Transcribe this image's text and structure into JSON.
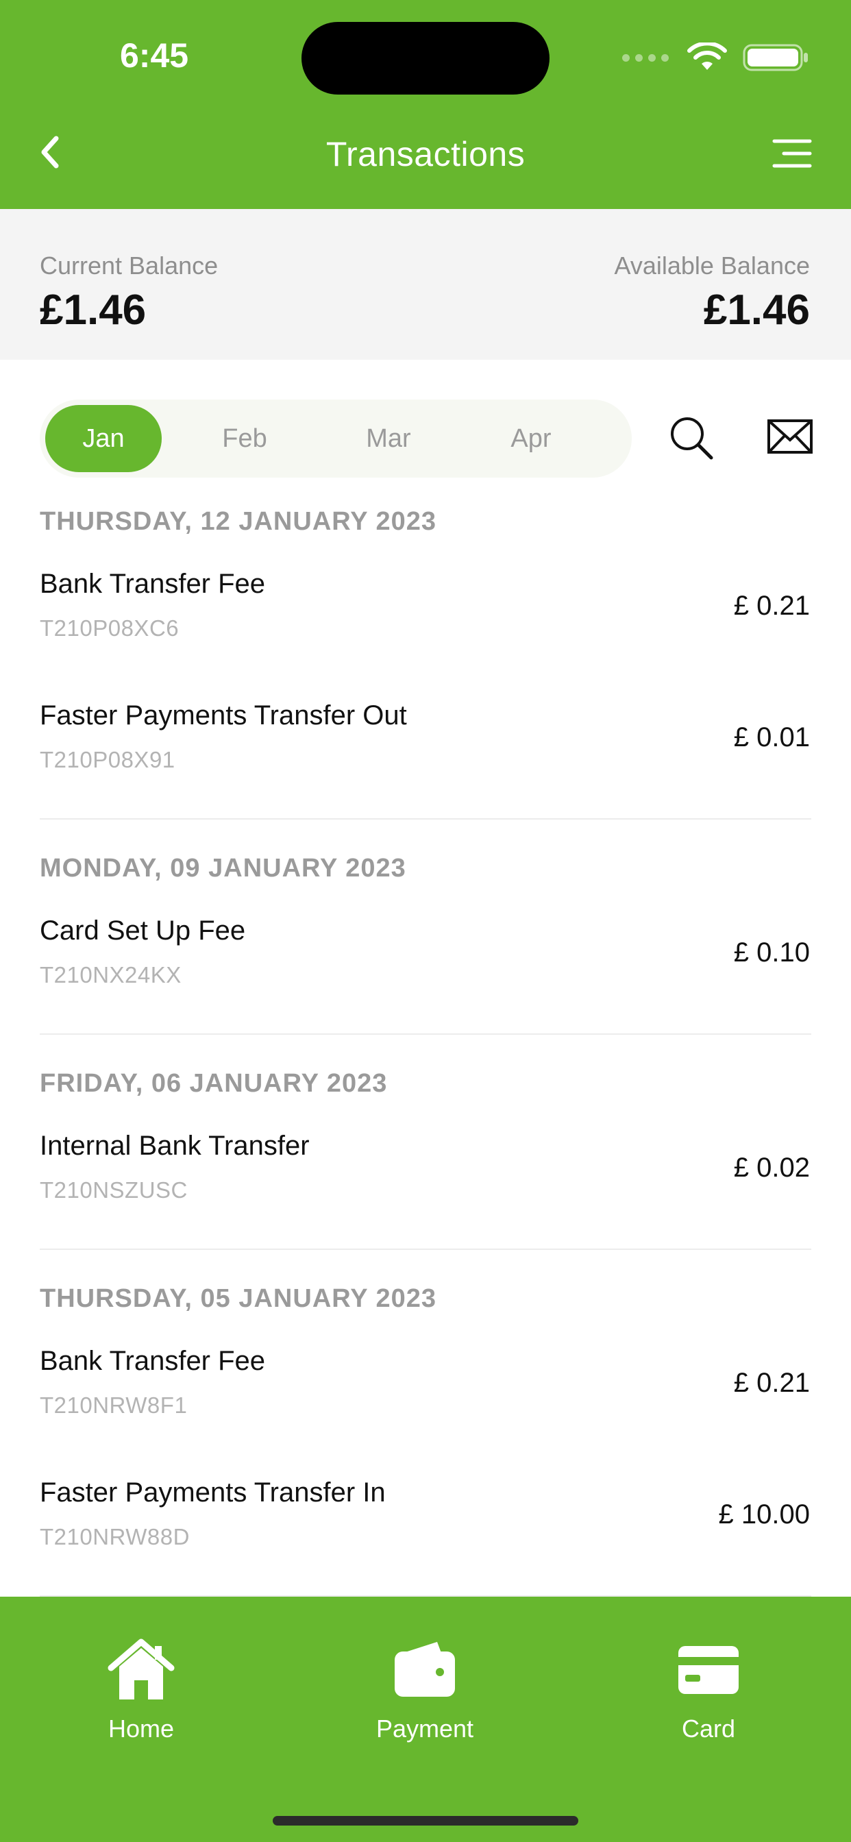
{
  "status_bar": {
    "time": "6:45"
  },
  "nav": {
    "title": "Transactions",
    "back_icon": "chevron-left-icon",
    "menu_icon": "menu-icon"
  },
  "balance": {
    "current_label": "Current Balance",
    "current_value": "£1.46",
    "available_label": "Available Balance",
    "available_value": "£1.46"
  },
  "months": [
    {
      "label": "Jan",
      "active": true
    },
    {
      "label": "Feb",
      "active": false
    },
    {
      "label": "Mar",
      "active": false
    },
    {
      "label": "Apr",
      "active": false
    }
  ],
  "groups": [
    {
      "date": "THURSDAY, 12 JANUARY 2023",
      "transactions": [
        {
          "name": "Bank Transfer Fee",
          "ref": "T210P08XC6",
          "amount": "£ 0.21"
        },
        {
          "name": "Faster Payments Transfer Out",
          "ref": "T210P08X91",
          "amount": "£ 0.01"
        }
      ]
    },
    {
      "date": "MONDAY, 09 JANUARY 2023",
      "transactions": [
        {
          "name": "Card Set Up Fee",
          "ref": "T210NX24KX",
          "amount": "£ 0.10"
        }
      ]
    },
    {
      "date": "FRIDAY, 06 JANUARY 2023",
      "transactions": [
        {
          "name": "Internal Bank Transfer",
          "ref": "T210NSZUSC",
          "amount": "£ 0.02"
        }
      ]
    },
    {
      "date": "THURSDAY, 05 JANUARY 2023",
      "transactions": [
        {
          "name": "Bank Transfer Fee",
          "ref": "T210NRW8F1",
          "amount": "£ 0.21"
        },
        {
          "name": "Faster Payments Transfer In",
          "ref": "T210NRW88D",
          "amount": "£ 10.00"
        }
      ]
    }
  ],
  "tabbar": {
    "home_label": "Home",
    "payment_label": "Payment",
    "card_label": "Card"
  },
  "colors": {
    "brand_green": "#67b72e",
    "muted_text": "#9a9a9a"
  }
}
